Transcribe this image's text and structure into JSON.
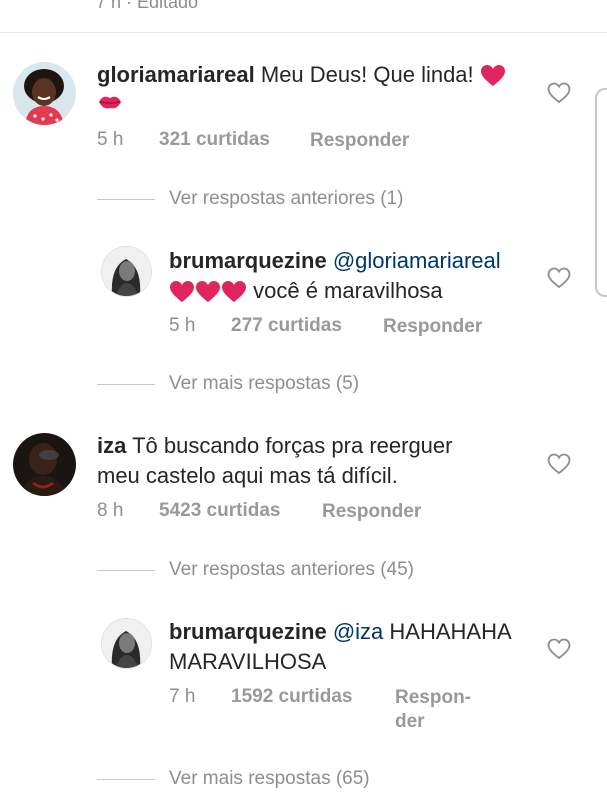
{
  "top": {
    "meta": "7 h · Editado"
  },
  "comments": [
    {
      "username": "gloriamariareal",
      "text": "Meu Deus! Que linda!",
      "time": "5 h",
      "likes": "321 curtidas",
      "reply": "Responder",
      "more_replies": "Ver respostas anteriores (1)",
      "replies": [
        {
          "username": "brumarquezine",
          "mention": "@gloriamariareal",
          "text": "você é maravilhosa",
          "time": "5 h",
          "likes": "277 curtidas",
          "reply": "Responder"
        }
      ],
      "after_replies": "Ver mais respostas (5)"
    },
    {
      "username": "iza",
      "text_line1": "Tô buscando forças pra reerguer",
      "text_line2": "meu castelo aqui mas tá difícil.",
      "time": "8 h",
      "likes": "5423 curtidas",
      "reply": "Responder",
      "more_replies": "Ver respostas anteriores (45)",
      "replies": [
        {
          "username": "brumarquezine",
          "mention": "@iza",
          "text_line1": "HAHAHAHA",
          "text_line2": "MARAVILHOSA",
          "time": "7 h",
          "likes": "1592 curtidas",
          "reply_line1": "Respon-",
          "reply_line2": "der"
        }
      ],
      "after_replies": "Ver mais respostas (65)"
    }
  ],
  "colors": {
    "heart_red": "#e0245e",
    "mention": "#003569"
  }
}
